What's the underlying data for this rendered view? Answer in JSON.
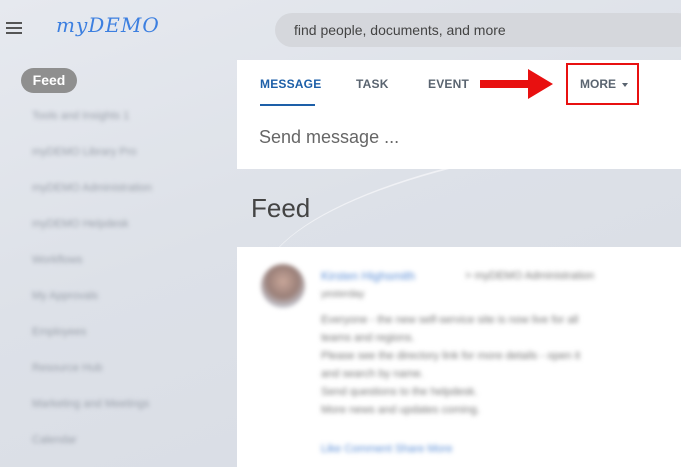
{
  "app": {
    "logo_text": "myDEMO"
  },
  "search": {
    "placeholder": "find people, documents, and more"
  },
  "sidebar": {
    "active": "Feed",
    "items": [
      "Tools and Insights 1",
      "myDEMO Library Pro",
      "myDEMO Administration",
      "myDEMO Helpdesk",
      "Workflows",
      "My Approvals",
      "Employees",
      "Resource Hub",
      "Marketing and Meetings",
      "Calendar"
    ]
  },
  "compose": {
    "tabs": [
      "MESSAGE",
      "TASK",
      "EVENT"
    ],
    "more_label": "MORE",
    "placeholder": "Send message ..."
  },
  "feed": {
    "title": "Feed",
    "post": {
      "author": "Kirsten Highsmith",
      "meta": "> myDEMO Administration",
      "date": "yesterday",
      "lines": [
        "Everyone - the new self-service site is now live for all",
        "teams and regions.",
        "Please see the directory link for more details - open it",
        "and search by name.",
        "Send questions to the helpdesk.",
        "More news and updates coming."
      ],
      "actions": "Like  Comment  Share  More"
    }
  },
  "colors": {
    "accent": "#1d5fa8",
    "highlight": "#e81010"
  }
}
